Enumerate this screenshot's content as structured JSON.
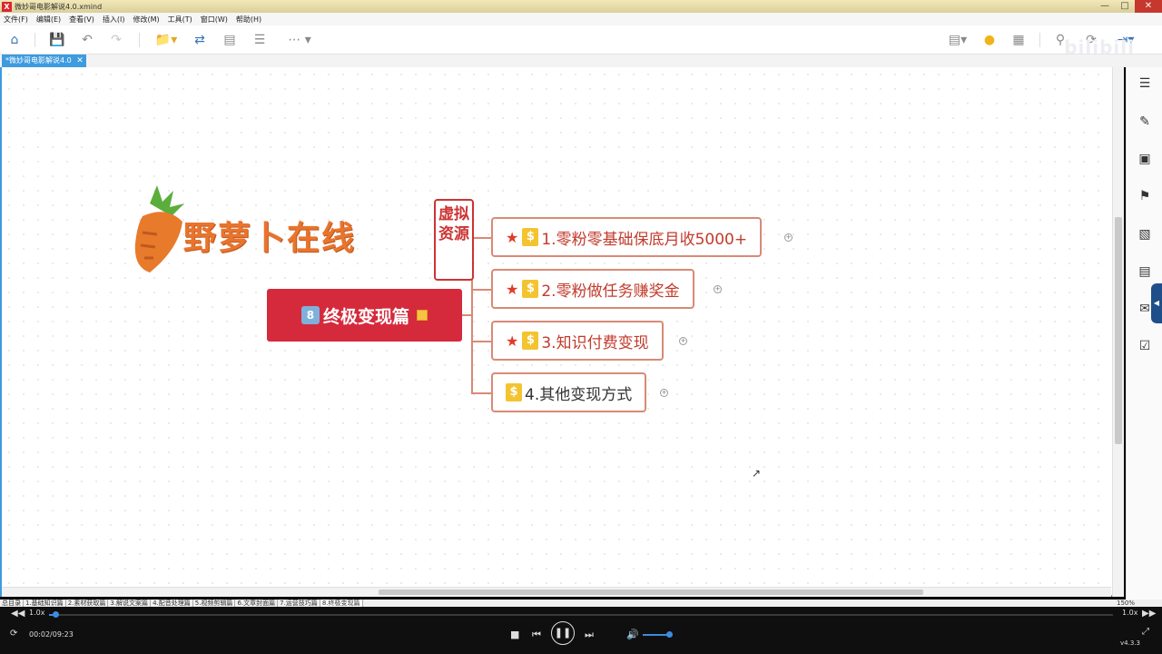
{
  "window": {
    "title": "微妙哥电影解说4.0.xmind",
    "controls": [
      "—",
      "□",
      "✕"
    ]
  },
  "menu": [
    "文件(F)",
    "编辑(E)",
    "查看(V)",
    "插入(I)",
    "修改(M)",
    "工具(T)",
    "窗口(W)",
    "帮助(H)"
  ],
  "doc_tab": {
    "label": "*微妙哥电影解说4.0",
    "close": "✕"
  },
  "watermark": "bilibili",
  "mindmap": {
    "logo_text": "野萝卜在线",
    "seal_text": "虚拟资源",
    "central": {
      "badge": "8",
      "label": "终极变现篇"
    },
    "branches": [
      {
        "label": "1.零粉零基础保底月收5000+",
        "star": true
      },
      {
        "label": "2.零粉做任务赚奖金",
        "star": true
      },
      {
        "label": "3.知识付费变现",
        "star": true
      },
      {
        "label": "4.其他变现方式",
        "star": false
      }
    ],
    "star_glyph": "★",
    "dollar_glyph": "$",
    "expand_glyph": "+"
  },
  "sheet_tabs": [
    "总目录",
    "1.基础知识篇",
    "2.素材获取篇",
    "3.解说文案篇",
    "4.配音处理篇",
    "5.视频剪辑篇",
    "6.文章封面篇",
    "7.运营技巧篇",
    "8.终极变现篇"
  ],
  "zoom": "150%",
  "player": {
    "speed_left": "1.0x",
    "speed_right": "1.0x",
    "time": "00:02/09:23",
    "progress": 0.004,
    "version": "v4.3.3"
  },
  "colors": {
    "accent": "#3d9be0",
    "central": "#d52a3c",
    "branch_border": "#d88a76",
    "branch_text": "#c23b2c",
    "logo": "#e8742e"
  },
  "icons": {
    "toolbar": [
      "home-icon",
      "save-icon",
      "undo-icon",
      "redo-icon",
      "open-folder-icon",
      "sync-icon",
      "export-icon",
      "outline-icon",
      "more-icon"
    ],
    "right_panel": [
      "outline-panel-icon",
      "format-brush-icon",
      "image-icon",
      "flag-icon",
      "text-icon",
      "notes-icon",
      "comment-icon",
      "task-icon"
    ]
  }
}
